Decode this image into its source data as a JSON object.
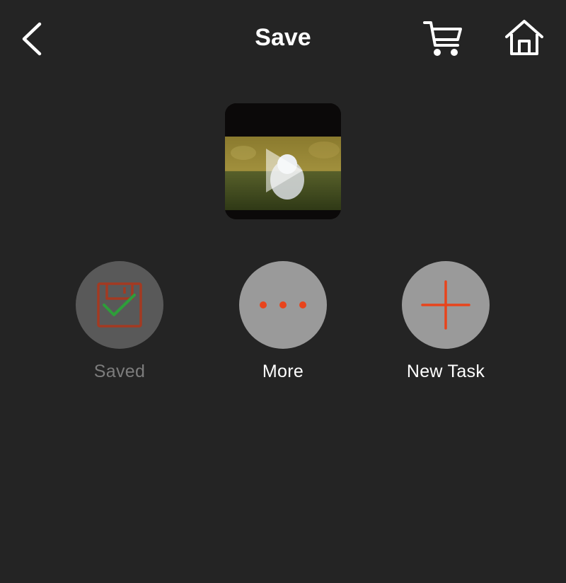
{
  "header": {
    "title": "Save",
    "back_icon": "chevron-left-icon",
    "cart_icon": "cart-icon",
    "home_icon": "home-icon"
  },
  "preview": {
    "play_icon": "play-icon"
  },
  "actions": [
    {
      "label": "Saved",
      "icon": "floppy-check-icon"
    },
    {
      "label": "More",
      "icon": "more-dots-icon"
    },
    {
      "label": "New Task",
      "icon": "plus-icon"
    }
  ],
  "colors": {
    "background": "#242424",
    "accent": "#e8441c",
    "check": "#2e9e3a",
    "button_active": "#9a9a9a",
    "button_disabled": "#595959",
    "disabled_text": "#7c7c7c"
  }
}
